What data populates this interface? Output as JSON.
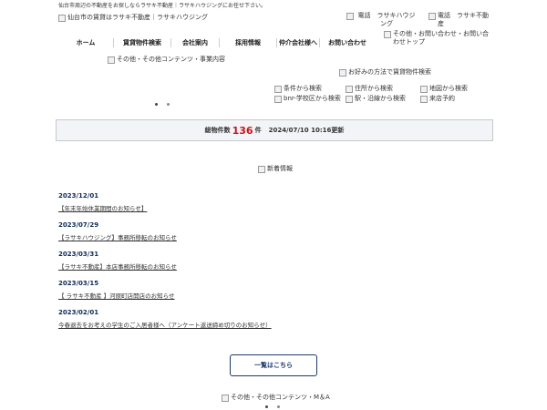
{
  "header": {
    "tagline": "仙台市周辺の不動産をお探しならラサキ不動産｜ラサキハウジングにお任せ下さい。",
    "logo_alt": "仙台市の賃貸はラサキ不動産｜ラサキハウジング",
    "phone1_alt": "電話　ラサキハウジング",
    "phone2_alt": "電話　ラサキ不動産",
    "contact_alt": "その他・お問い合わせ・お問い合わせトップ"
  },
  "nav": {
    "items": [
      {
        "label": "ホーム"
      },
      {
        "label": "賃貸物件検索"
      },
      {
        "label": "会社案内"
      },
      {
        "label": "採用情報"
      },
      {
        "label": "仲介会社様へ"
      },
      {
        "label": "お問い合わせ"
      }
    ]
  },
  "banner": {
    "alt": "その他・その他コンテンツ・事業内容"
  },
  "search": {
    "title_alt": "お好みの方法で賃貸物件検索",
    "items": [
      {
        "alt": "条件から検索"
      },
      {
        "alt": "住所から検索"
      },
      {
        "alt": "地図から検索"
      },
      {
        "alt": "bnr-学校区から検索"
      },
      {
        "alt": "駅・沿線から検索"
      },
      {
        "alt": "来店予約"
      }
    ]
  },
  "count": {
    "label": "総物件数",
    "value": "136",
    "unit": "件",
    "updated": "2024/07/10 10:16更新"
  },
  "news": {
    "title_alt": "新着情報",
    "items": [
      {
        "date": "2023/12/01",
        "title": "【年末年始休業期間のお知らせ】"
      },
      {
        "date": "2023/07/29",
        "title": "【ラサキハウジング】事務所移転のお知らせ"
      },
      {
        "date": "2023/03/31",
        "title": "【ラサキ不動産】本店事務所移転のお知らせ"
      },
      {
        "date": "2023/03/15",
        "title": "【 ラサキ不動産 】河原町店開店のお知らせ"
      },
      {
        "date": "2023/02/01",
        "title": "今春退去をお考えの学生のご入居者様へ（アンケート返送締め切りのお知らせ）"
      }
    ],
    "more_label": "一覧はこちら"
  },
  "footer": {
    "banner_alt": "その他・その他コンテンツ・M＆A"
  }
}
